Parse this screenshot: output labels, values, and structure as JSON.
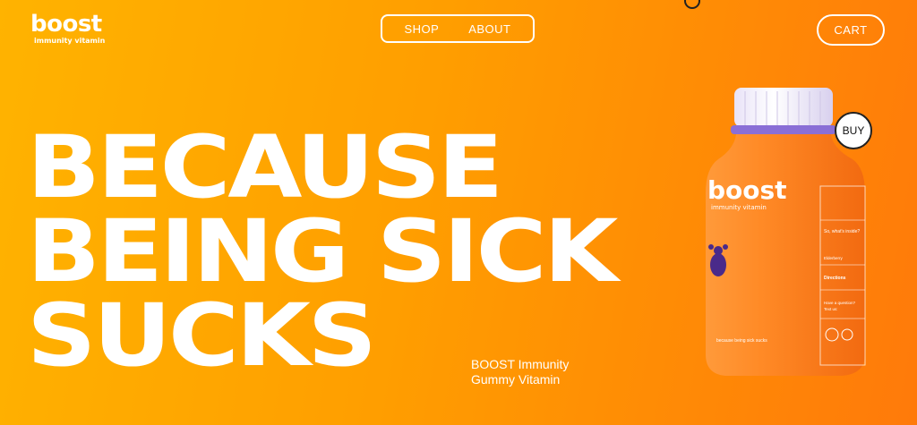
{
  "brand": {
    "name": "boost",
    "tagline": "immunity vitamin"
  },
  "nav": {
    "shop": "SHOP",
    "about": "ABOUT"
  },
  "cart": "CART",
  "hero": {
    "headline": [
      "BECAUSE",
      "BEING SICK",
      "SUCKS"
    ],
    "subtitle": [
      "BOOST Immunity",
      "Gummy Vitamin"
    ]
  },
  "product": {
    "label_brand": "boost",
    "label_sub": "immunity vitamin",
    "label_tag": "because being sick sucks",
    "whats_inside": "So, what's inside?",
    "elderberry": "Elderberry",
    "directions": "Directions",
    "question": "Have a question?",
    "text_us": "Text us:",
    "buy": "BUY"
  },
  "colors": {
    "bg_start": "#ffb300",
    "bg_end": "#ff7a0a",
    "bottle": "#ff7f1f",
    "cap": "#f5f0ff"
  }
}
